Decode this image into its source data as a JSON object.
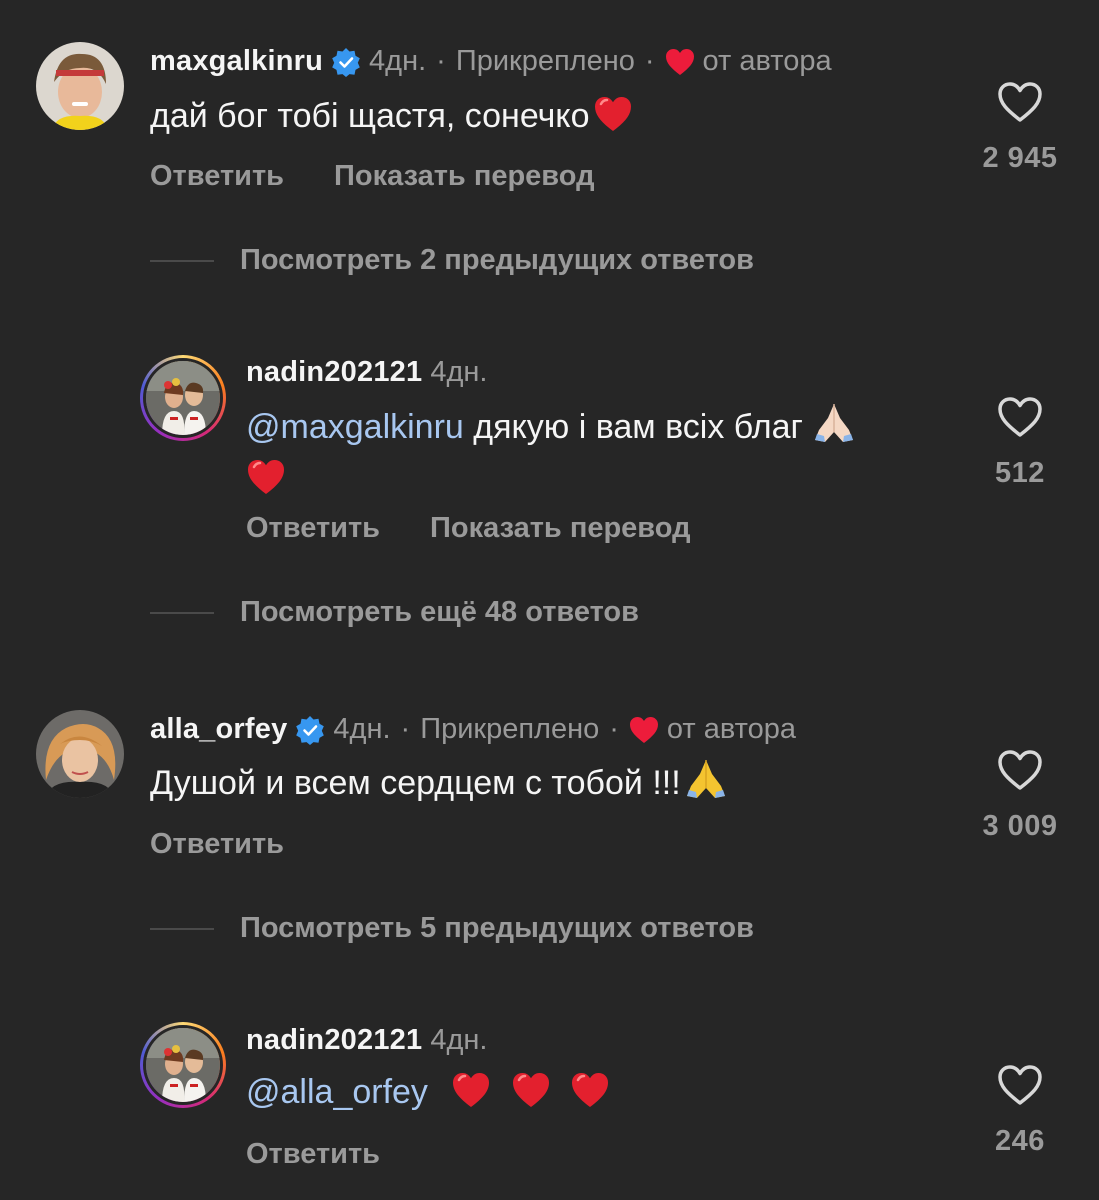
{
  "comments": [
    {
      "username": "maxgalkinru",
      "time": "4дн.",
      "pinned": "Прикреплено",
      "by_author": "от автора",
      "text": "дай бог тобі щастя, сонечко",
      "reply": "Ответить",
      "translate": "Показать перевод",
      "likes": "2 945",
      "view_replies": "Посмотреть 2 предыдущих ответов"
    },
    {
      "username": "nadin202121",
      "time": "4дн.",
      "mention": "@maxgalkinru",
      "text": " дякую і вам всіх благ",
      "reply": "Ответить",
      "translate": "Показать перевод",
      "likes": "512",
      "view_replies": "Посмотреть ещё 48 ответов"
    },
    {
      "username": "alla_orfey",
      "time": "4дн.",
      "pinned": "Прикреплено",
      "by_author": "от автора",
      "text": "Душой и всем сердцем с тобой !!!",
      "reply": "Ответить",
      "likes": "3 009",
      "view_replies": "Посмотреть 5 предыдущих ответов"
    },
    {
      "username": "nadin202121",
      "time": "4дн.",
      "mention": "@alla_orfey",
      "reply": "Ответить",
      "likes": "246"
    }
  ],
  "icons": {
    "verified": "verified-badge-icon",
    "heart_red": "red-heart-icon",
    "like": "heart-outline-icon",
    "pray": "folded-hands-emoji"
  },
  "colors": {
    "background": "#262626",
    "text": "#f5f5f5",
    "secondary": "#9a9a9a",
    "verified": "#3797f0",
    "heart": "#ed1c3b",
    "mention": "#a8c7f0"
  }
}
